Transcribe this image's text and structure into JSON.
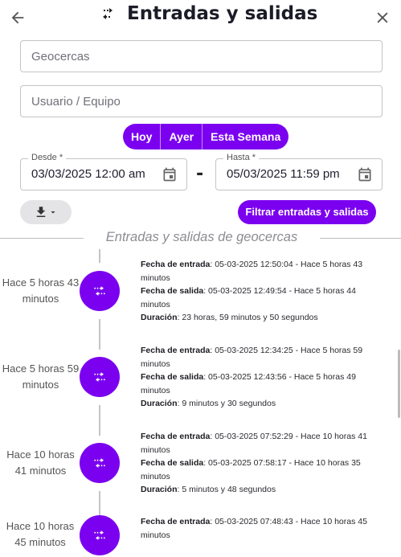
{
  "header": {
    "title": "Entradas y salidas",
    "back_icon": "arrow-left-icon",
    "title_icon": "swap-arrows-icon",
    "close_icon": "close-icon"
  },
  "filters": {
    "geofences_placeholder": "Geocercas",
    "user_placeholder": "Usuario / Equipo",
    "range_buttons": [
      "Hoy",
      "Ayer",
      "Esta Semana"
    ],
    "from_label": "Desde *",
    "from_value": "03/03/2025 12:00 am",
    "to_label": "Hasta *",
    "to_value": "05/03/2025 11:59 pm",
    "separator": "-",
    "download_icon": "download-icon",
    "filter_button": "Filtrar entradas y salidas"
  },
  "section": {
    "title": "Entradas y salidas de geocercas"
  },
  "labels": {
    "entry": "Fecha de entrada",
    "exit": "Fecha de salida",
    "duration": "Duración"
  },
  "events": [
    {
      "ago": "Hace 5 horas 43 minutos",
      "entry": "05-03-2025 12:50:04 - Hace 5 horas 43 minutos",
      "exit": "05-03-2025 12:49:54 - Hace 5 horas 44 minutos",
      "duration": "23 horas, 59 minutos y 50 segundos"
    },
    {
      "ago": "Hace 5 horas 59 minutos",
      "entry": "05-03-2025 12:34:25 - Hace 5 horas 59 minutos",
      "exit": "05-03-2025 12:43:56 - Hace 5 horas 49 minutos",
      "duration": "9 minutos y 30 segundos"
    },
    {
      "ago": "Hace 10 horas 41 minutos",
      "entry": "05-03-2025 07:52:29 - Hace 10 horas 41 minutos",
      "exit": "05-03-2025 07:58:17 - Hace 10 horas 35 minutos",
      "duration": "5 minutos y 48 segundos"
    },
    {
      "ago": "Hace 10 horas 45 minutos",
      "entry": "05-03-2025 07:48:43 - Hace 10 horas 45 minutos"
    }
  ],
  "colors": {
    "accent": "#7b00f0",
    "border": "#c4c4c8",
    "muted": "#8c8c94"
  }
}
